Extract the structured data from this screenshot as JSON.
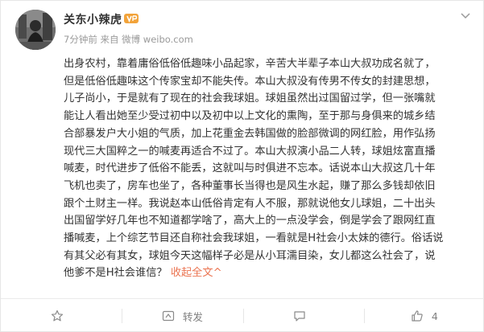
{
  "post": {
    "author": "关东小辣虎",
    "meta": {
      "time": "7分钟前",
      "source_label": "来自",
      "client": "微博",
      "domain": "weibo.com"
    },
    "lines": [
      "出身农村，靠着庸俗低俗低趣味小品起家，辛苦大半辈子本山大叔功成名就了，",
      "但是低俗低趣味这个传家宝却不能失传。本山大叔没有传男不传女的封建思想，",
      "儿子尚小，于是就有了现在的社会我球姐。球姐虽然出过国留过学，但一张嘴就",
      "能让人看出她至少受过初中以及初中以上文化的熏陶，至于那与身俱来的城乡结",
      "合部暴发户大小姐的气质，加上花重金去韩国做的脸部微调的网红脸，用作弘扬",
      "现代三大国粹之一的喊麦再适合不过了。本山大叔演小品二人转，球姐炫富直播",
      "喊麦，时代进步了低俗不能丢，这就叫与时俱进不忘本。话说本山大叔这几十年",
      "飞机也卖了，房车也坐了，各种董事长当得也是风生水起，赚了那么多钱却依旧",
      "跟个土财主一样。我说赵本山低俗肯定有人不服，那就说他女儿球姐，二十出头",
      "出国留学好几年也不知道都学啥了，高大上的一点没学会，倒是学会了跟网红直",
      "播喊麦，上个综艺节目还自称社会我球姐，一看就是H社会小太妹的德行。俗话说",
      "有其父必有其女，球姐今天这幅样子必是从小耳濡目染，女儿都这么社会了，说",
      "他爹不是H社会谁信？"
    ],
    "collapse_label": "收起全文",
    "collapse_arrow": "^"
  },
  "footer": {
    "favorite_count": "",
    "repost_label": "转发",
    "comment_count": "",
    "like_count": "4"
  },
  "colors": {
    "link": "#eb7350",
    "meta": "#999999",
    "text": "#333333",
    "badge": "#f2a33a"
  },
  "icons": {
    "vip": "vip-badge-icon",
    "chevron": "chevron-down-icon",
    "favorite": "star-icon",
    "repost": "repost-icon",
    "comment": "comment-icon",
    "like": "thumbs-up-icon"
  }
}
